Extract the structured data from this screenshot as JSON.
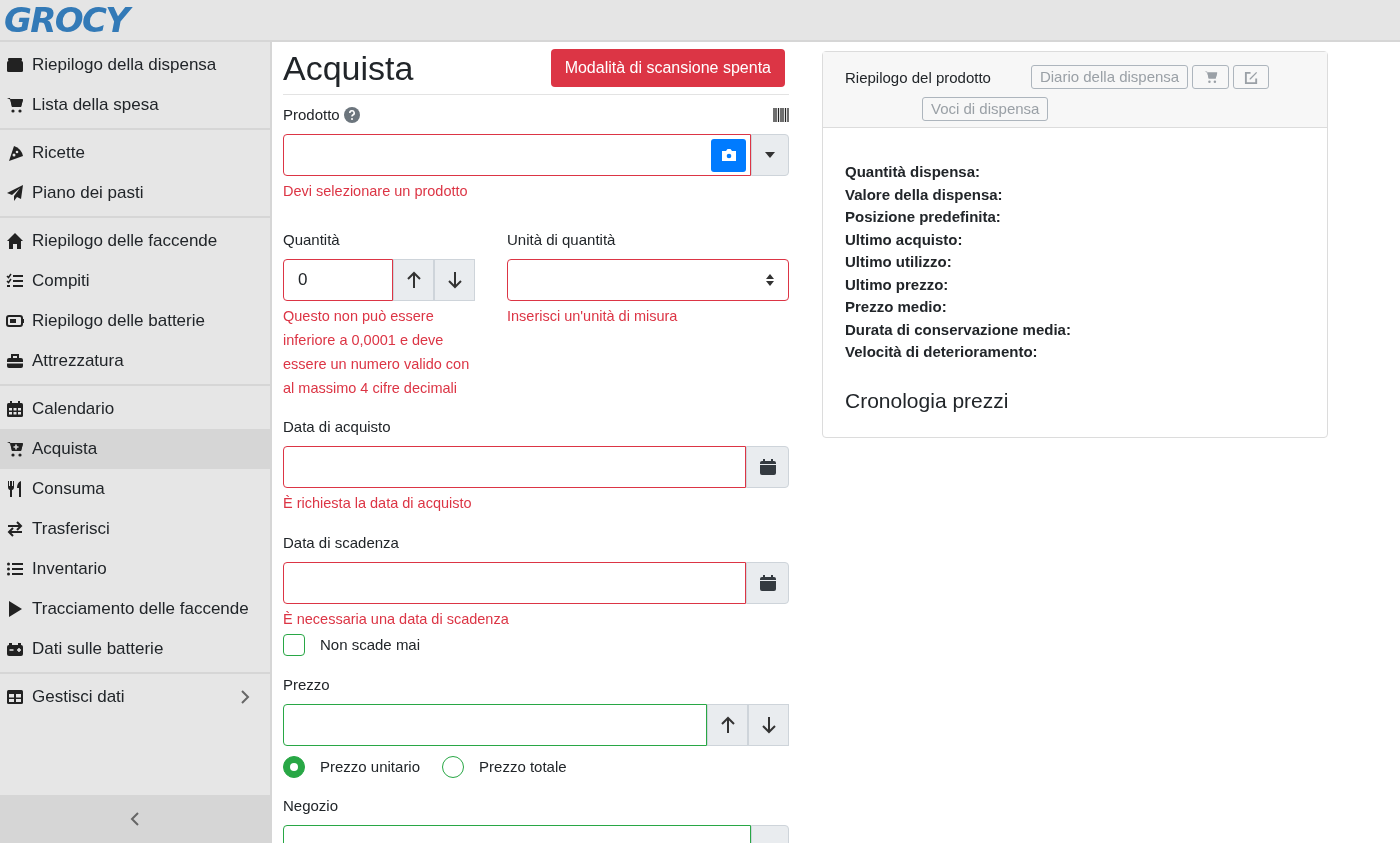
{
  "logo": "GROCY",
  "sidebar": {
    "groups": [
      [
        {
          "label": "Riepilogo della dispensa",
          "selected": false,
          "kind": "link"
        },
        {
          "label": "Lista della spesa",
          "selected": false,
          "kind": "link"
        }
      ],
      [
        {
          "label": "Ricette",
          "selected": false,
          "kind": "link"
        },
        {
          "label": "Piano dei pasti",
          "selected": false,
          "kind": "link"
        }
      ],
      [
        {
          "label": "Riepilogo delle faccende",
          "selected": false,
          "kind": "link"
        },
        {
          "label": "Compiti",
          "selected": false,
          "kind": "link"
        },
        {
          "label": "Riepilogo delle batterie",
          "selected": false,
          "kind": "link"
        },
        {
          "label": "Attrezzatura",
          "selected": false,
          "kind": "link"
        }
      ],
      [
        {
          "label": "Calendario",
          "selected": false,
          "kind": "link"
        },
        {
          "label": "Acquista",
          "selected": true,
          "kind": "link"
        },
        {
          "label": "Consuma",
          "selected": false,
          "kind": "link"
        },
        {
          "label": "Trasferisci",
          "selected": false,
          "kind": "link"
        },
        {
          "label": "Inventario",
          "selected": false,
          "kind": "link"
        },
        {
          "label": "Tracciamento delle faccende",
          "selected": false,
          "kind": "link"
        },
        {
          "label": "Dati sulle batterie",
          "selected": false,
          "kind": "link"
        }
      ],
      [
        {
          "label": "Gestisci dati",
          "selected": false,
          "kind": "submenu"
        }
      ]
    ]
  },
  "form": {
    "title": "Acquista",
    "scan_button": "Modalità di scansione spenta",
    "product": {
      "label": "Prodotto",
      "error": "Devi selezionare un prodotto",
      "valid": false
    },
    "quantity": {
      "label": "Quantità",
      "value": "0",
      "error": "Questo non può essere inferiore a 0,0001 e deve essere un numero valido con al massimo 4 cifre decimali",
      "valid": false
    },
    "unit": {
      "label": "Unità di quantità",
      "error": "Inserisci un'unità di misura",
      "valid": false
    },
    "purchase_date": {
      "label": "Data di acquisto",
      "error": "È richiesta la data di acquisto",
      "valid": false
    },
    "due_date": {
      "label": "Data di scadenza",
      "error": "È necessaria una data di scadenza",
      "valid": false
    },
    "never_expires": {
      "label": "Non scade mai",
      "checked": false
    },
    "price": {
      "label": "Prezzo",
      "valid": true
    },
    "price_type": [
      {
        "label": "Prezzo unitario",
        "selected": true
      },
      {
        "label": "Prezzo totale",
        "selected": false
      }
    ],
    "store": {
      "label": "Negozio",
      "valid": true
    }
  },
  "product_card": {
    "title": "Riepilogo del prodotto",
    "buttons": [
      "Diario della dispensa",
      "Voci di dispensa"
    ],
    "fields": [
      "Quantità dispensa:",
      "Valore della dispensa:",
      "Posizione predefinita:",
      "Ultimo acquisto:",
      "Ultimo utilizzo:",
      "Ultimo prezzo:",
      "Prezzo medio:",
      "Durata di conservazione media:",
      "Velocità di deterioramento:"
    ],
    "price_history_title": "Cronologia prezzi"
  }
}
